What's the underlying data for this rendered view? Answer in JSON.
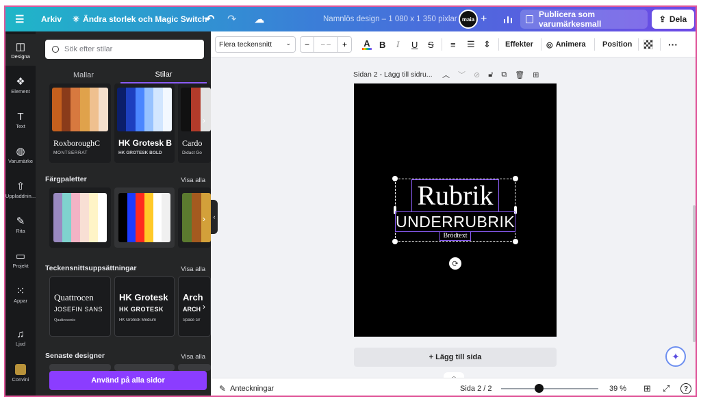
{
  "topbar": {
    "menu_icon": "hamburger-icon",
    "file_label": "Arkiv",
    "resize_label": "Ändra storlek och Magic Switch",
    "title": "Namnlös design – 1 080 x 1 350 pixlar",
    "avatar_text": "maia",
    "publish_label": "Publicera som varumärkesmall",
    "share_label": "Dela"
  },
  "rail": {
    "items": [
      {
        "label": "Designa",
        "icon": "layout-icon"
      },
      {
        "label": "Element",
        "icon": "shapes-icon"
      },
      {
        "label": "Text",
        "icon": "text-icon"
      },
      {
        "label": "Varumärke",
        "icon": "brand-icon"
      },
      {
        "label": "Uppladdnin...",
        "icon": "upload-icon"
      },
      {
        "label": "Rita",
        "icon": "draw-icon"
      },
      {
        "label": "Projekt",
        "icon": "folder-icon"
      },
      {
        "label": "Appar",
        "icon": "apps-icon"
      },
      {
        "label": "Ljud",
        "icon": "music-icon"
      },
      {
        "label": "Convini",
        "icon": "app-icon"
      }
    ]
  },
  "panel": {
    "search_placeholder": "Sök efter stilar",
    "tabs": [
      {
        "label": "Mallar"
      },
      {
        "label": "Stilar"
      }
    ],
    "style_cards": [
      {
        "title": "RoxboroughC",
        "subtitle": "MONTSERRAT",
        "colors": [
          "#c4601e",
          "#8a3b1a",
          "#d7793f",
          "#e0a24b",
          "#efc08f",
          "#f4dfcc"
        ]
      },
      {
        "title": "HK Grotesk B",
        "subtitle": "HK GROTESK BOLD",
        "colors": [
          "#0b1e6b",
          "#1d3fbf",
          "#4b86ff",
          "#97c2ff",
          "#d2e6ff",
          "#f3f8ff"
        ]
      },
      {
        "title": "Cardo",
        "subtitle": "Didact Go",
        "colors": [
          "#111111",
          "#b33b2a",
          "#e3e3e3"
        ]
      }
    ],
    "palettes_title": "Färgpaletter",
    "palettes_see_all": "Visa alla",
    "palettes": [
      {
        "colors": [
          "#9a8ac1",
          "#7fd3ce",
          "#f3b3c5",
          "#f8dfd4",
          "#fff4c7",
          "#ffffff"
        ]
      },
      {
        "colors": [
          "#000000",
          "#1c3bff",
          "#ff2a1e",
          "#ffc928",
          "#ffffff",
          "#f0f0f0"
        ]
      },
      {
        "colors": [
          "#5b7a2f",
          "#a45a1f",
          "#d3a03a"
        ]
      }
    ],
    "fonts_title": "Teckensnittsuppsättningar",
    "fonts_see_all": "Visa alla",
    "font_cards": [
      {
        "title": "Quattrocen",
        "subtitle": "JOSEFIN SANS",
        "body": "Quattrocento"
      },
      {
        "title": "HK Grotesk",
        "subtitle": "HK GROTESK",
        "body": "HK Grotesk Medium"
      },
      {
        "title": "Arch",
        "subtitle": "ARCH",
        "body": "Space Gr"
      }
    ],
    "recent_title": "Senaste designer",
    "recent_see_all": "Visa alla",
    "apply_label": "Använd på alla sidor"
  },
  "toolbar": {
    "font_family": "Flera teckensnitt",
    "size_value": "– –",
    "effects_label": "Effekter",
    "animate_label": "Animera",
    "position_label": "Position"
  },
  "page": {
    "header": "Sidan 2 - Lägg till sidru...",
    "heading": "Rubrik",
    "subheading": "UNDERRUBRIK",
    "body": "Brödtext",
    "add_page_label": "+ Lägg till sida"
  },
  "bottombar": {
    "notes_label": "Anteckningar",
    "page_indicator": "Sida 2 / 2",
    "zoom": "39 %",
    "zoom_fraction": 0.39,
    "help_label": "?"
  }
}
